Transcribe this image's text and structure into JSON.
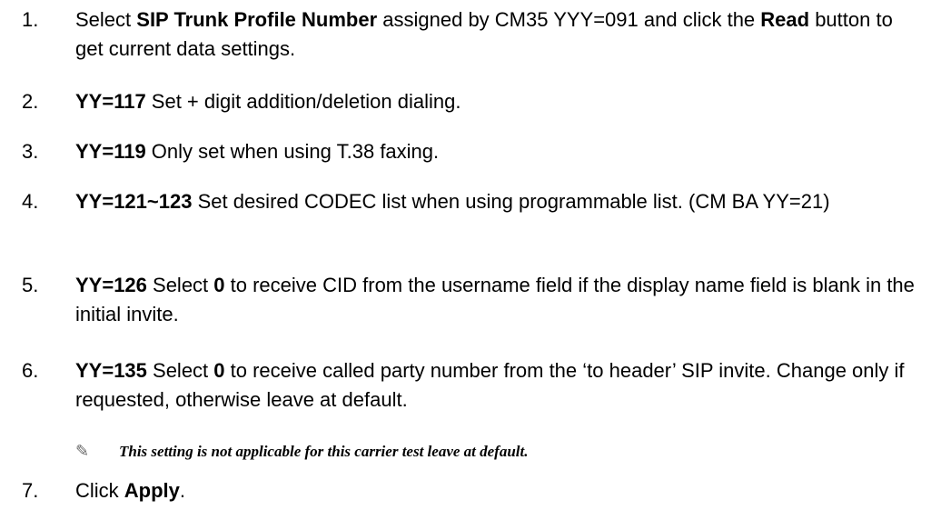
{
  "steps": [
    {
      "number": "1.",
      "parts": [
        {
          "t": "Select "
        },
        {
          "t": "SIP Trunk Profile Number",
          "b": true
        },
        {
          "t": " assigned by CM35 YYY=091 and click the "
        },
        {
          "t": "Read",
          "b": true
        },
        {
          "t": " button to get current data settings."
        }
      ]
    },
    {
      "number": "2.",
      "parts": [
        {
          "t": "YY=117",
          "b": true
        },
        {
          "t": " Set + digit addition/deletion dialing."
        }
      ]
    },
    {
      "number": "3.",
      "parts": [
        {
          "t": "YY=119",
          "b": true
        },
        {
          "t": " Only set when using T.38 faxing."
        }
      ]
    },
    {
      "number": "4.",
      "parts": [
        {
          "t": "YY=121~123",
          "b": true
        },
        {
          "t": " Set desired CODEC list when using programmable list. (CM BA YY=21)"
        }
      ]
    },
    {
      "number": "5.",
      "parts": [
        {
          "t": "YY=126",
          "b": true
        },
        {
          "t": " Select "
        },
        {
          "t": "0",
          "b": true
        },
        {
          "t": " to receive CID from the username field if the display name field is blank in the initial invite."
        }
      ]
    },
    {
      "number": "6.",
      "parts": [
        {
          "t": "YY=135",
          "b": true
        },
        {
          "t": " Select "
        },
        {
          "t": "0",
          "b": true
        },
        {
          "t": " to receive called party number from the ‘to header’ SIP invite. Change only if requested, otherwise leave at default."
        }
      ]
    },
    {
      "number": "7.",
      "parts": [
        {
          "t": "Click "
        },
        {
          "t": "Apply",
          "b": true
        },
        {
          "t": "."
        }
      ]
    }
  ],
  "note": {
    "icon": "pencil-icon",
    "text": "This setting is not applicable for this carrier test leave at default."
  }
}
